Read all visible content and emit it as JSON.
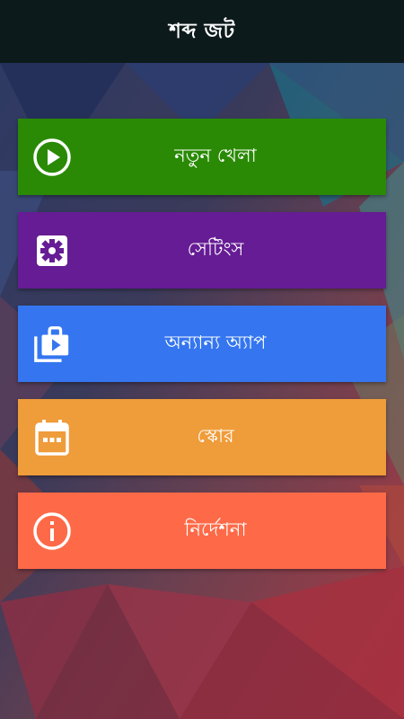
{
  "header": {
    "title": "শব্দ জট"
  },
  "theme": {
    "header_bg": "#0d1a1c"
  },
  "menu": [
    {
      "label": "নতুন খেলা",
      "icon": "play-circle-icon",
      "color": "#2a8a05"
    },
    {
      "label": "সেটিংস",
      "icon": "settings-gear-icon",
      "color": "#661c94"
    },
    {
      "label": "অন্যান্য অ্যাপ",
      "icon": "app-store-icon",
      "color": "#3576f0"
    },
    {
      "label": "স্কোর",
      "icon": "calendar-icon",
      "color": "#ef9c3a"
    },
    {
      "label": "নির্দেশনা",
      "icon": "info-icon",
      "color": "#fe6a48"
    }
  ]
}
